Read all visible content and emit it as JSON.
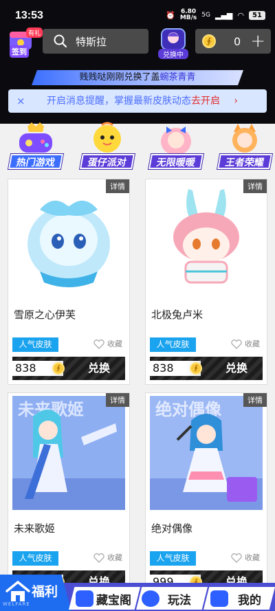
{
  "status_bar": {
    "time": "13:53",
    "speed_value": "6.80",
    "speed_unit": "MB/s",
    "network": "5G",
    "battery": "51"
  },
  "header": {
    "checkin_badge": "有礼",
    "checkin_label": "签到",
    "search_value": "特斯拉",
    "exchange_label": "兑换中",
    "coin_balance": "0",
    "coin_symbol": "∮",
    "add_label": "+"
  },
  "ticker": {
    "text": "贱贱哒刚刚兑换了盖",
    "highlight": "蜿茶青青"
  },
  "notify_bar": {
    "close": "×",
    "text": "开启消息提醒，掌握最新皮肤动态",
    "action": "去开启",
    "chevron": "›"
  },
  "categories": [
    {
      "label": "热门游戏",
      "active": true
    },
    {
      "label": "蛋仔派对",
      "active": false
    },
    {
      "label": "无限暖暖",
      "active": false
    },
    {
      "label": "王者荣耀",
      "active": false
    }
  ],
  "products": [
    {
      "name": "雪原之心伊芙",
      "detail": "详情",
      "tag": "人气皮肤",
      "fav": "收藏",
      "price": "838",
      "action": "兑换",
      "art_text": ""
    },
    {
      "name": "北极兔卢米",
      "detail": "详情",
      "tag": "人气皮肤",
      "fav": "收藏",
      "price": "838",
      "action": "兑换",
      "art_text": ""
    },
    {
      "name": "未来歌姬",
      "detail": "详情",
      "tag": "人气皮肤",
      "fav": "收藏",
      "price": "",
      "action": "兑换",
      "art_text": "未来歌姬"
    },
    {
      "name": "绝对偶像",
      "detail": "详情",
      "tag": "人气皮肤",
      "fav": "收藏",
      "price": "999",
      "action": "兑换",
      "art_text": "绝对偶像"
    }
  ],
  "bottom_nav": {
    "active": "福利",
    "active_sub": "WELFARE",
    "tabs": [
      "藏宝阁",
      "玩法",
      "我的"
    ]
  },
  "colors": {
    "accent_blue": "#1aa3ee",
    "nav_purple": "#4b4dd2",
    "alert_red": "#e02d2d"
  }
}
